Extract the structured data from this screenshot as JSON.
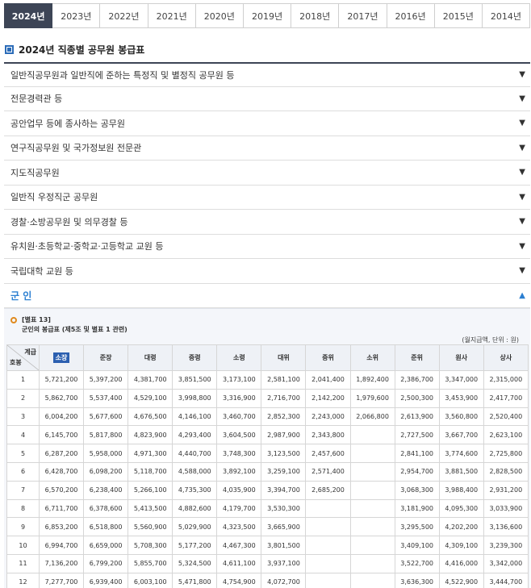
{
  "years": [
    "2024년",
    "2023년",
    "2022년",
    "2021년",
    "2020년",
    "2019년",
    "2018년",
    "2017년",
    "2016년",
    "2015년",
    "2014년"
  ],
  "active_year": "2024년",
  "section_title": "2024년 직종별 공무원 봉급표",
  "accordion": [
    "일반직공무원과 일반직에 준하는 특정직 및 별정직 공무원 등",
    "전문경력관 등",
    "공안업무 등에 종사하는 공무원",
    "연구직공무원 및 국가정보원 전문관",
    "지도직공무원",
    "일반직 우정직군 공무원",
    "경찰·소방공무원 및 의무경찰 등",
    "유치원·초등학교·중학교·고등학교 교원 등",
    "국립대학 교원 등"
  ],
  "open_item": "군 인",
  "note": {
    "line1": "[별표 13]",
    "line2": "군인의 봉급표 (제5조 및 별표 1 관련)"
  },
  "unit": "(월지급액, 단위 : 원)",
  "table": {
    "corner_top": "계급",
    "corner_bottom": "호봉",
    "columns": [
      "소장",
      "준장",
      "대령",
      "중령",
      "소령",
      "대위",
      "중위",
      "소위",
      "준위",
      "원사",
      "상사"
    ],
    "rows": [
      [
        "1",
        "5,721,200",
        "5,397,200",
        "4,381,700",
        "3,851,500",
        "3,173,100",
        "2,581,100",
        "2,041,400",
        "1,892,400",
        "2,386,700",
        "3,347,000",
        "2,315,000"
      ],
      [
        "2",
        "5,862,700",
        "5,537,400",
        "4,529,100",
        "3,998,800",
        "3,316,900",
        "2,716,700",
        "2,142,200",
        "1,979,600",
        "2,500,300",
        "3,453,900",
        "2,417,700"
      ],
      [
        "3",
        "6,004,200",
        "5,677,600",
        "4,676,500",
        "4,146,100",
        "3,460,700",
        "2,852,300",
        "2,243,000",
        "2,066,800",
        "2,613,900",
        "3,560,800",
        "2,520,400"
      ],
      [
        "4",
        "6,145,700",
        "5,817,800",
        "4,823,900",
        "4,293,400",
        "3,604,500",
        "2,987,900",
        "2,343,800",
        "",
        "2,727,500",
        "3,667,700",
        "2,623,100"
      ],
      [
        "5",
        "6,287,200",
        "5,958,000",
        "4,971,300",
        "4,440,700",
        "3,748,300",
        "3,123,500",
        "2,457,600",
        "",
        "2,841,100",
        "3,774,600",
        "2,725,800"
      ],
      [
        "6",
        "6,428,700",
        "6,098,200",
        "5,118,700",
        "4,588,000",
        "3,892,100",
        "3,259,100",
        "2,571,400",
        "",
        "2,954,700",
        "3,881,500",
        "2,828,500"
      ],
      [
        "7",
        "6,570,200",
        "6,238,400",
        "5,266,100",
        "4,735,300",
        "4,035,900",
        "3,394,700",
        "2,685,200",
        "",
        "3,068,300",
        "3,988,400",
        "2,931,200"
      ],
      [
        "8",
        "6,711,700",
        "6,378,600",
        "5,413,500",
        "4,882,600",
        "4,179,700",
        "3,530,300",
        "",
        "",
        "3,181,900",
        "4,095,300",
        "3,033,900"
      ],
      [
        "9",
        "6,853,200",
        "6,518,800",
        "5,560,900",
        "5,029,900",
        "4,323,500",
        "3,665,900",
        "",
        "",
        "3,295,500",
        "4,202,200",
        "3,136,600"
      ],
      [
        "10",
        "6,994,700",
        "6,659,000",
        "5,708,300",
        "5,177,200",
        "4,467,300",
        "3,801,500",
        "",
        "",
        "3,409,100",
        "4,309,100",
        "3,239,300"
      ],
      [
        "11",
        "7,136,200",
        "6,799,200",
        "5,855,700",
        "5,324,500",
        "4,611,100",
        "3,937,100",
        "",
        "",
        "3,522,700",
        "4,416,000",
        "3,342,000"
      ],
      [
        "12",
        "7,277,700",
        "6,939,400",
        "6,003,100",
        "5,471,800",
        "4,754,900",
        "4,072,700",
        "",
        "",
        "3,636,300",
        "4,522,900",
        "3,444,700"
      ]
    ]
  },
  "icons": {
    "collapsed": "▼",
    "expanded": "▲"
  },
  "colors": {
    "active_tab": "#3d4556",
    "accent_blue": "#2b7fd1",
    "note_orange": "#e08a1e"
  }
}
